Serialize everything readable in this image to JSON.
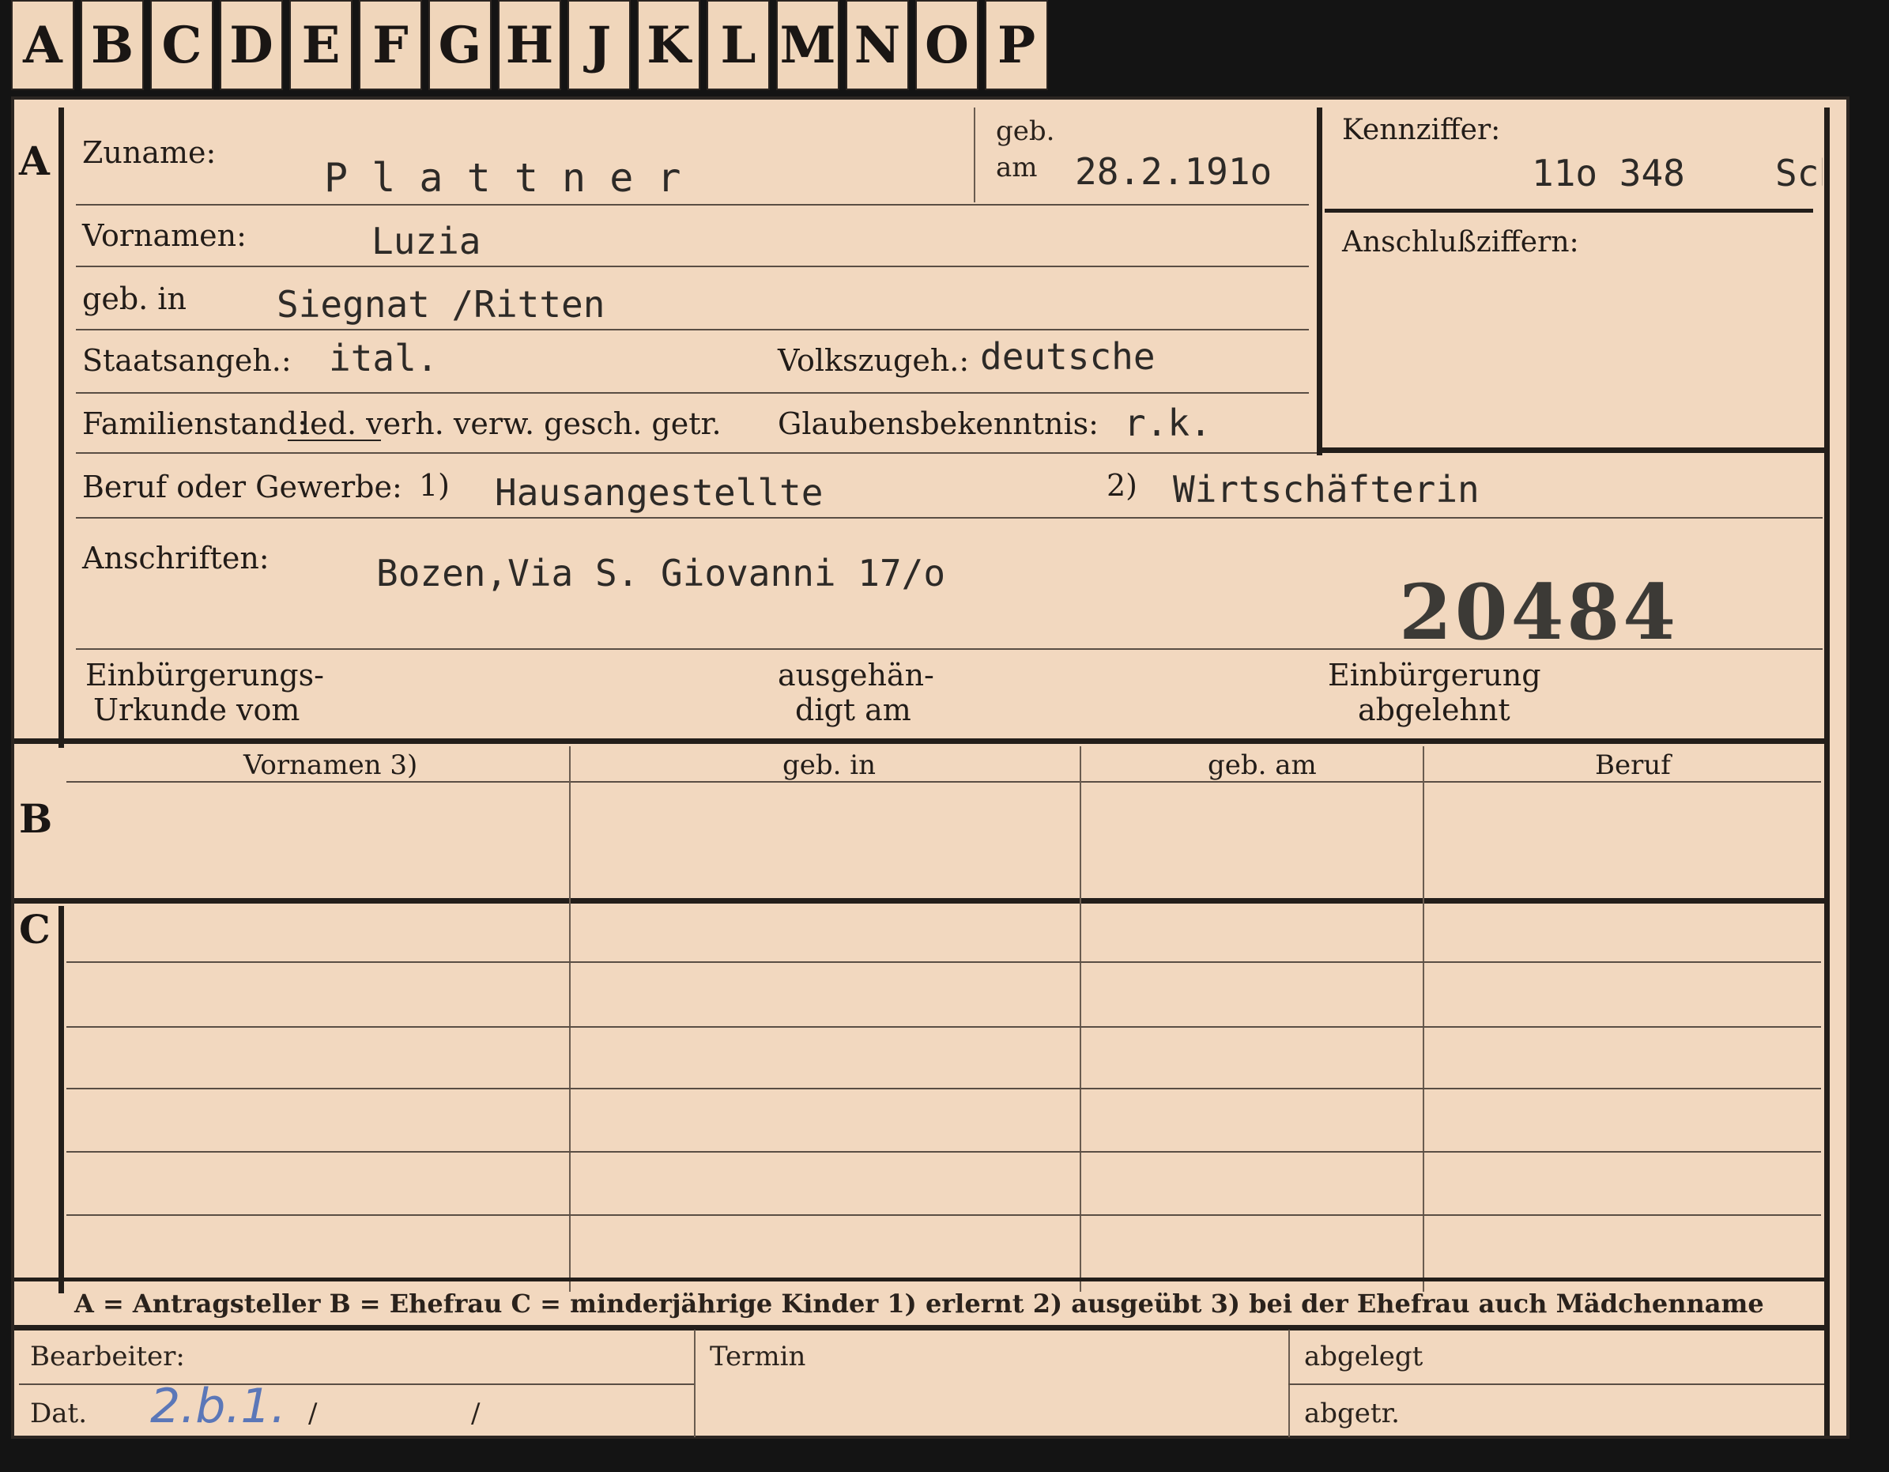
{
  "tabs": [
    "A",
    "B",
    "C",
    "D",
    "E",
    "F",
    "G",
    "H",
    "J",
    "K",
    "L",
    "M",
    "N",
    "O",
    "P"
  ],
  "sections": {
    "a": "A",
    "b": "B",
    "c": "C"
  },
  "person": {
    "surname_label": "Zuname:",
    "surname": "P l a t t n e r",
    "born_label_1": "geb.",
    "born_label_2": "am",
    "birth_date": "28.2.191o",
    "first_names_label": "Vornamen:",
    "first_names": "Luzia",
    "birthplace_label": "geb. in",
    "birthplace": "Siegnat /Ritten",
    "citizenship_label": "Staatsangeh.:",
    "citizenship": "ital.",
    "ethnicity_label": "Volkszugeh.:",
    "ethnicity": "deutsche",
    "family_status_label": "Familienstand:",
    "family_status_options": "led. verh. verw. gesch. getr.",
    "religion_label": "Glaubensbekenntnis:",
    "religion": "r.k.",
    "occupation_label": "Beruf oder Gewerbe:",
    "occupation_marker_1": "1)",
    "occupation_learned": "Hausangestellte",
    "occupation_marker_2": "2)",
    "occupation_practiced": "Wirtschäfterin",
    "addresses_label": "Anschriften:",
    "address": "Bozen,Via S. Giovanni 17/o",
    "stamp_number": "20484"
  },
  "id_box": {
    "code_label": "Kennziffer:",
    "code": "11o 348",
    "code_suffix": "Sch",
    "connection_label": "Anschlußziffern:"
  },
  "naturalization": {
    "certificate_label_1": "Einbürgerungs-",
    "certificate_label_2": "Urkunde vom",
    "issued_label_1": "ausgehän-",
    "issued_label_2": "digt am",
    "refused_label_1": "Einbürgerung",
    "refused_label_2": "abgelehnt"
  },
  "table_headers": [
    "Vornamen 3)",
    "geb. in",
    "geb. am",
    "Beruf"
  ],
  "legend": "A = Antragsteller   B = Ehefrau   C = minderjährige Kinder   1) erlernt   2) ausgeübt   3) bei der Ehefrau auch Mädchenname",
  "footer": {
    "clerk_label": "Bearbeiter:",
    "date_label": "Dat.",
    "date_value": "2.b.1.",
    "slash_1": "/",
    "slash_2": "/",
    "deadline_label": "Termin",
    "filed_label": "abgelegt",
    "filed_date_label": "abgetr."
  },
  "colors": {
    "card": "#f2d8bf",
    "ink": "#2d2a27",
    "background": "#141414",
    "pen": "#5b77b8"
  }
}
